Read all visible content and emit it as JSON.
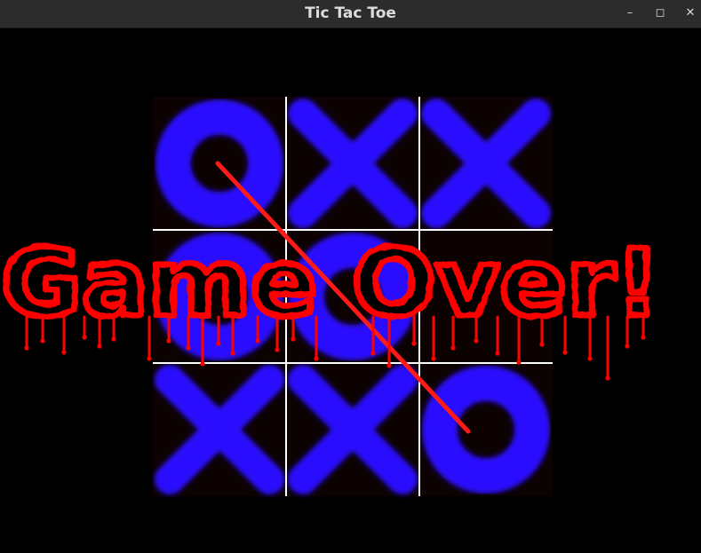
{
  "window": {
    "title": "Tic Tac Toe",
    "minimize_icon": "minimize-icon",
    "maximize_icon": "maximize-icon",
    "close_icon": "close-icon"
  },
  "board": {
    "cells": [
      [
        "O",
        "X",
        "X"
      ],
      [
        "O",
        "O",
        ""
      ],
      [
        "X",
        "X",
        "O"
      ]
    ],
    "winning_line": "diagonal",
    "colors": {
      "cell_background": "#0c0202",
      "mark": "#2a10ff",
      "grid_line": "#ffffff",
      "win_line": "#ff1a1a"
    }
  },
  "message": {
    "text": "Game Over!",
    "color": "#ff0000",
    "style": "dripping-blood"
  }
}
